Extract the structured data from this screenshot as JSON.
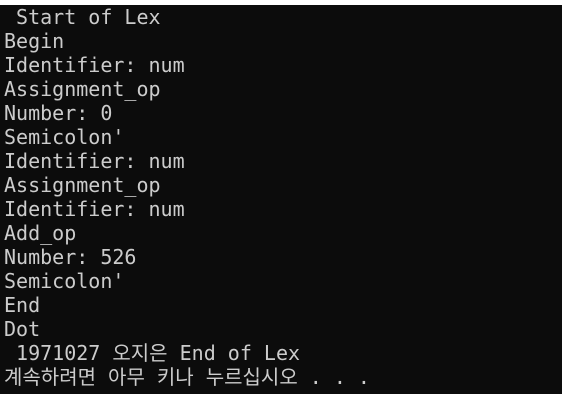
{
  "console": {
    "lines": [
      " Start of Lex",
      "Begin",
      "Identifier: num",
      "Assignment_op",
      "Number: 0",
      "Semicolon'",
      "Identifier: num",
      "Assignment_op",
      "Identifier: num",
      "Add_op",
      "Number: 526",
      "Semicolon'",
      "End",
      "Dot",
      " 1971027 오지은 End of Lex",
      "계속하려면 아무 키나 누르십시오 . . ."
    ]
  },
  "colors": {
    "background": "#0c0c0c",
    "text": "#cccccc"
  }
}
